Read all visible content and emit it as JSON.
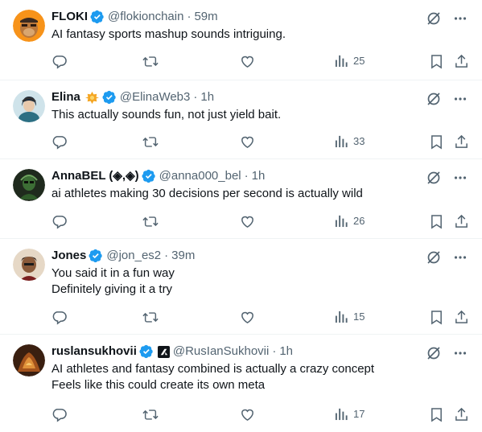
{
  "tweets": [
    {
      "name": "FLOKI",
      "handle": "@flokionchain",
      "separator": "·",
      "time": "59m",
      "lines": [
        "AI fantasy sports mashup sounds intriguing."
      ],
      "views": "25",
      "avatar_color": "#f7931a"
    },
    {
      "name": "Elina",
      "handle": "@ElinaWeb3",
      "separator": "·",
      "time": "1h",
      "lines": [
        "This actually sounds fun, not just yield bait."
      ],
      "views": "33",
      "avatar_color": "#cfe3ea"
    },
    {
      "name": "AnnaBEL (◈,◈)",
      "handle": "@anna000_bel",
      "separator": "·",
      "time": "1h",
      "lines": [
        "ai athletes making 30 decisions per second is actually wild"
      ],
      "views": "26",
      "avatar_color": "#1f2a1d"
    },
    {
      "name": "Jones",
      "handle": "@jon_es2",
      "separator": "·",
      "time": "39m",
      "lines": [
        "You said it in a fun way",
        "Definitely giving it a try"
      ],
      "views": "15",
      "avatar_color": "#e6d8c6"
    },
    {
      "name": "ruslansukhovii",
      "handle": "@RusIanSukhovii",
      "separator": "·",
      "time": "1h",
      "lines": [
        "AI athletes and fantasy combined is actually a crazy concept",
        "Feels like this could create its own meta"
      ],
      "views": "17",
      "avatar_color": "#3a1f10"
    }
  ],
  "colors": {
    "verified_blue": "#1d9bf0",
    "muted_text": "#536471",
    "primary_text": "#0f1419",
    "divider": "#eff3f4"
  },
  "icons": [
    "grok-icon",
    "more-icon",
    "reply-icon",
    "retweet-icon",
    "like-icon",
    "views-icon",
    "bookmark-icon",
    "share-icon",
    "verified-badge-icon"
  ]
}
